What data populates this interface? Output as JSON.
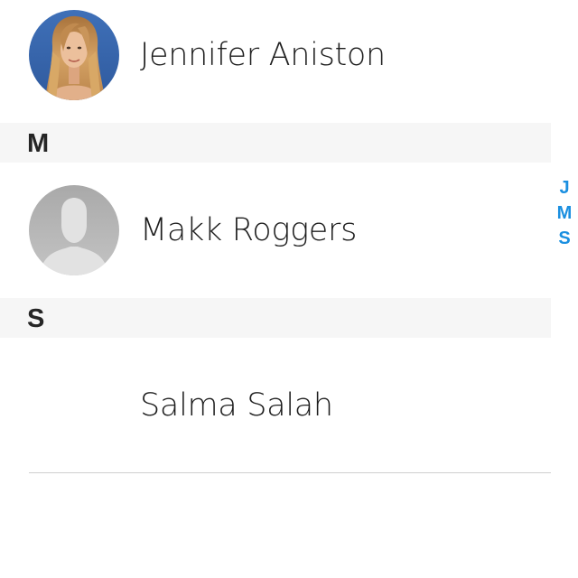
{
  "contacts": [
    {
      "name": "Jennifer Aniston",
      "avatar": "photo-avatar"
    },
    {
      "name": "Makk Roggers",
      "avatar": "placeholder-person-icon"
    },
    {
      "name": "Salma Salah",
      "avatar": "none"
    }
  ],
  "sections": [
    {
      "letter": "M"
    },
    {
      "letter": "S"
    }
  ],
  "index_bar": {
    "letters": [
      "J",
      "M",
      "S"
    ]
  },
  "colors": {
    "index_accent": "#1a8fe0",
    "section_background": "#f6f6f6",
    "name_text": "#1e1e1e",
    "avatar_placeholder": "#b8b8b8"
  }
}
